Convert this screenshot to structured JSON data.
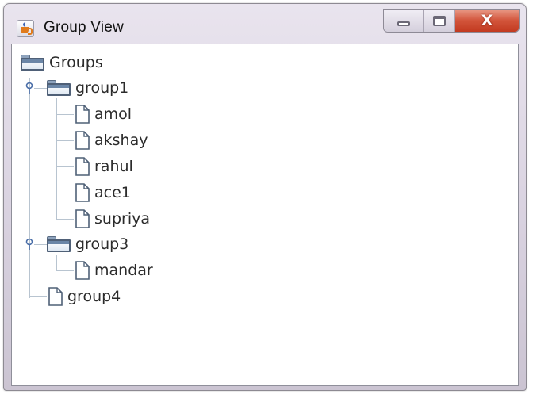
{
  "window": {
    "title": "Group View",
    "close_glyph": "X"
  },
  "tree": {
    "root": {
      "label": "Groups",
      "icon": "folder-icon"
    },
    "groups": [
      {
        "label": "group1",
        "icon": "folder-icon",
        "expanded": true,
        "children": [
          "amol",
          "akshay",
          "rahul",
          "ace1",
          "supriya"
        ]
      },
      {
        "label": "group3",
        "icon": "folder-icon",
        "expanded": true,
        "children": [
          "mandar"
        ]
      },
      {
        "label": "group4",
        "icon": "file-icon",
        "expanded": false,
        "children": []
      }
    ]
  },
  "colors": {
    "close_button": "#d2543a",
    "tree_lines": "#b8c4d0",
    "folder_border": "#4f6077"
  }
}
